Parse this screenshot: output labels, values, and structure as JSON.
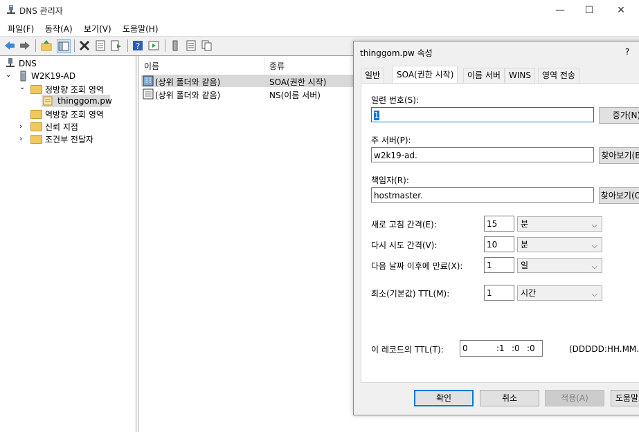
{
  "window": {
    "title": "DNS 관리자",
    "minimize": "—",
    "maximize": "☐",
    "close": "✕"
  },
  "menu": [
    "파일(F)",
    "동작(A)",
    "보기(V)",
    "도움말(H)"
  ],
  "tree": {
    "root": "DNS",
    "server": "W2K19-AD",
    "forward": "정방향 조회 영역",
    "zone": "thinggom.pw",
    "reverse": "역방향 조회 영역",
    "trust": "신뢰 지점",
    "conditional": "조건부 전달자"
  },
  "list": {
    "columns": [
      "이름",
      "종류"
    ],
    "rows": [
      {
        "name": "(상위 폴더와 같음)",
        "type": "SOA(권한 시작)"
      },
      {
        "name": "(상위 폴더와 같음)",
        "type": "NS(이름 서버)"
      }
    ]
  },
  "dialog": {
    "title": "thinggom.pw 속성",
    "help": "?",
    "tabs": [
      "일반",
      "SOA(권한 시작)",
      "이름 서버",
      "WINS",
      "영역 전송"
    ],
    "serial_label": "일련 번호(S):",
    "serial_value": "1",
    "increment_button": "증가(N)",
    "primary_label": "주 서버(P):",
    "primary_value": "w2k19-ad.",
    "browse1": "찾아보기(B)...",
    "responsible_label": "책임자(R):",
    "responsible_value": "hostmaster.",
    "browse2": "찾아보기(O)...",
    "refresh_label": "새로 고침 간격(E):",
    "refresh_value": "15",
    "refresh_unit": "분",
    "retry_label": "다시 시도 간격(V):",
    "retry_value": "10",
    "retry_unit": "분",
    "expire_label": "다음 날짜 이후에 만료(X):",
    "expire_value": "1",
    "expire_unit": "일",
    "minttl_label": "최소(기본값) TTL(M):",
    "minttl_value": "1",
    "minttl_unit": "시간",
    "recordttl_label": "이 레코드의 TTL(T):",
    "recordttl_d": "0",
    "recordttl_h": ":1",
    "recordttl_m": ":0",
    "recordttl_s": ":0",
    "recordttl_format": "(DDDDD:HH.MM.SS)",
    "ok": "확인",
    "cancel": "취소",
    "apply": "적용(A)",
    "helpbtn": "도움말"
  }
}
